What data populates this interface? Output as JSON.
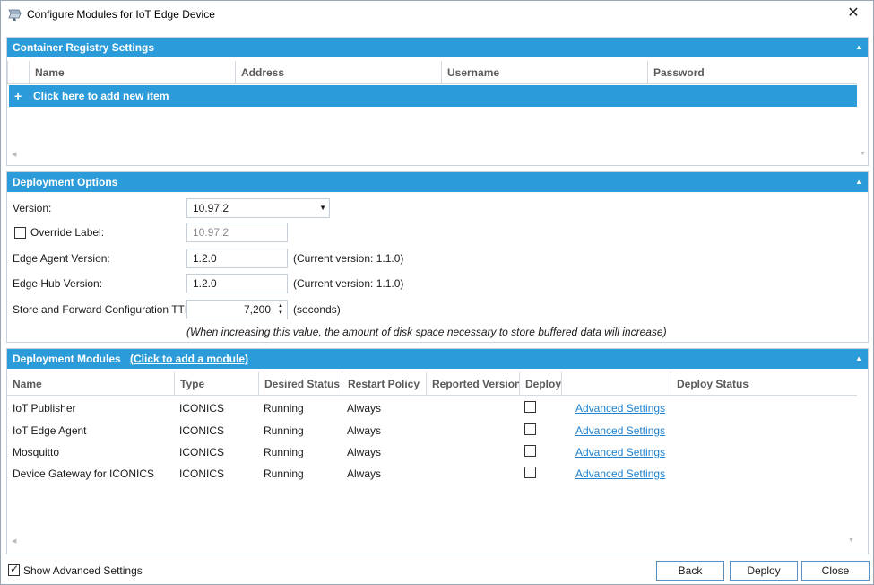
{
  "window": {
    "title": "Configure Modules for IoT Edge Device",
    "close_symbol": "✕"
  },
  "registry": {
    "title": "Container Registry Settings",
    "columns": [
      "Name",
      "Address",
      "Username",
      "Password"
    ],
    "add_item_label": "Click here to add new item"
  },
  "deployment_options": {
    "title": "Deployment Options",
    "version_label": "Version:",
    "version_value": "10.97.2",
    "override_label": "Override Label:",
    "override_checked": false,
    "override_value": "10.97.2",
    "agent_label": "Edge Agent Version:",
    "agent_value": "1.2.0",
    "agent_current": "(Current version: 1.1.0)",
    "hub_label": "Edge Hub Version:",
    "hub_value": "1.2.0",
    "hub_current": "(Current version: 1.1.0)",
    "ttl_label": "Store and Forward Configuration TTL:",
    "ttl_value": "7,200",
    "ttl_unit": "(seconds)",
    "ttl_note": "(When increasing this value, the amount of disk space necessary to store buffered data will increase)"
  },
  "modules": {
    "title": "Deployment Modules",
    "add_link": "(Click to add a module)",
    "columns": [
      "Name",
      "Type",
      "Desired Status",
      "Restart Policy",
      "Reported Version",
      "Deploy",
      "",
      "Deploy Status"
    ],
    "rows": [
      {
        "name": "IoT Publisher",
        "type": "ICONICS",
        "desired": "Running",
        "restart": "Always",
        "reported": "",
        "deploy": false,
        "settings": "Advanced Settings",
        "status": ""
      },
      {
        "name": "IoT Edge Agent",
        "type": "ICONICS",
        "desired": "Running",
        "restart": "Always",
        "reported": "",
        "deploy": false,
        "settings": "Advanced Settings",
        "status": ""
      },
      {
        "name": "Mosquitto",
        "type": "ICONICS",
        "desired": "Running",
        "restart": "Always",
        "reported": "",
        "deploy": false,
        "settings": "Advanced Settings",
        "status": ""
      },
      {
        "name": "Device Gateway for ICONICS",
        "type": "ICONICS",
        "desired": "Running",
        "restart": "Always",
        "reported": "",
        "deploy": false,
        "settings": "Advanced Settings",
        "status": ""
      }
    ]
  },
  "footer": {
    "show_advanced_label": "Show Advanced Settings",
    "show_advanced_checked": true,
    "back_label": "Back",
    "deploy_label": "Deploy",
    "close_label": "Close"
  },
  "colors": {
    "accent": "#2b9bd9",
    "link": "#1e82d0"
  }
}
